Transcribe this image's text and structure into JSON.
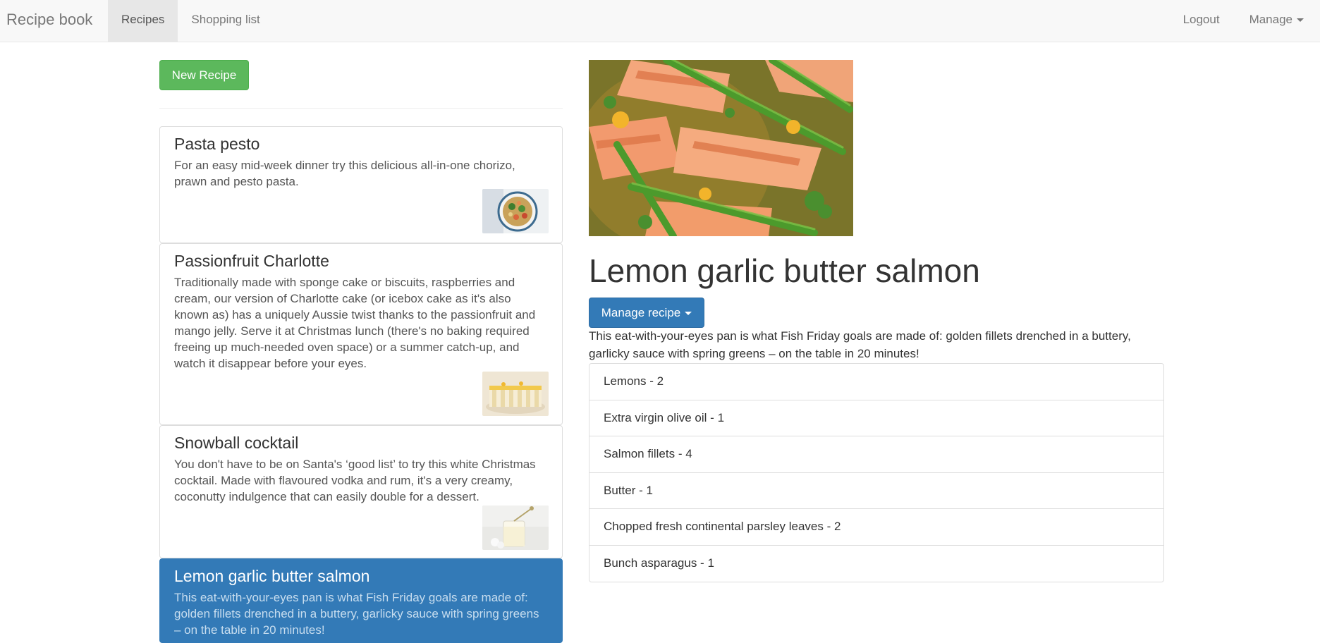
{
  "navbar": {
    "brand": "Recipe book",
    "links": [
      "Recipes",
      "Shopping list"
    ],
    "logout": "Logout",
    "manage": "Manage"
  },
  "sidebar": {
    "new_recipe_label": "New Recipe",
    "recipes": [
      {
        "name": "Pasta pesto",
        "description": "For an easy mid-week dinner try this delicious all-in-one chorizo, prawn and pesto pasta.",
        "thumbnail": "pasta-bowl-image"
      },
      {
        "name": "Passionfruit Charlotte",
        "description": "Traditionally made with sponge cake or biscuits, raspberries and cream, our version of Charlotte cake (or icebox cake as it's also known as) has a uniquely Aussie twist thanks to the passionfruit and mango jelly. Serve it at Christmas lunch (there's no baking required freeing up much-needed oven space) or a summer catch-up, and watch it disappear before your eyes.",
        "thumbnail": "charlotte-cake-image"
      },
      {
        "name": "Snowball cocktail",
        "description": "You don't have to be on Santa's ‘good list’ to try this white Christmas cocktail. Made with flavoured vodka and rum, it's a very creamy, coconutty indulgence that can easily double for a dessert.",
        "thumbnail": "cocktail-glass-image"
      },
      {
        "name": "Lemon garlic butter salmon",
        "description": "This eat-with-your-eyes pan is what Fish Friday goals are made of: golden fillets drenched in a buttery, garlicky sauce with spring greens – on the table in 20 minutes!",
        "active": true
      }
    ]
  },
  "detail": {
    "image": "salmon-asparagus-pan-image",
    "title": "Lemon garlic butter salmon",
    "manage_label": "Manage recipe",
    "description": "This eat-with-your-eyes pan is what Fish Friday goals are made of: golden fillets drenched in a buttery, garlicky sauce with spring greens – on the table in 20 minutes!",
    "ingredients": [
      {
        "name": "Lemons",
        "amount": "2"
      },
      {
        "name": "Extra virgin olive oil",
        "amount": "1"
      },
      {
        "name": "Salmon fillets",
        "amount": "4"
      },
      {
        "name": "Butter",
        "amount": "1"
      },
      {
        "name": "Chopped fresh continental parsley leaves",
        "amount": "2"
      },
      {
        "name": "Bunch asparagus",
        "amount": "1"
      }
    ]
  },
  "colors": {
    "primary": "#337ab7",
    "success": "#5cb85c",
    "navbar_bg": "#f8f8f8"
  }
}
